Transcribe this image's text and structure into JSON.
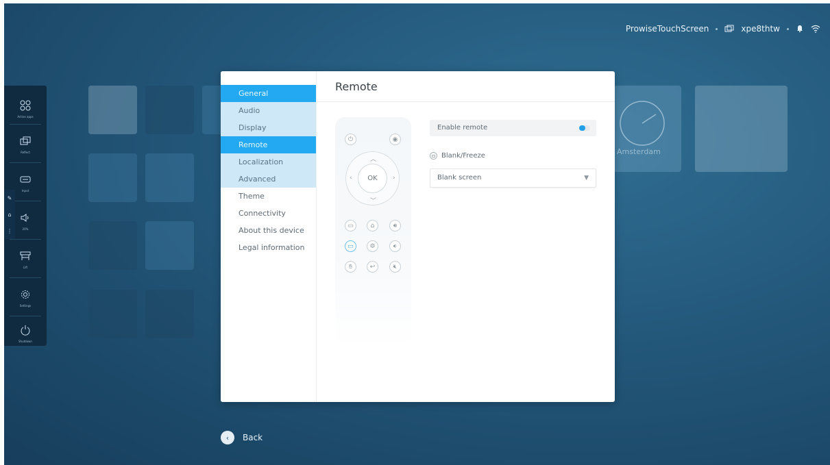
{
  "topbar": {
    "device_name": "ProwiseTouchScreen",
    "code": "xpe8thtw",
    "icons": [
      "screen-share-icon",
      "bell-icon",
      "wifi-icon"
    ]
  },
  "dock": {
    "items": [
      {
        "label": "Active apps",
        "icon": "grid-icon"
      },
      {
        "label": "Reflect",
        "icon": "screen-mirror-icon"
      },
      {
        "label": "Input",
        "icon": "input-icon"
      },
      {
        "label": "20%",
        "icon": "volume-icon"
      },
      {
        "label": "Lift",
        "icon": "lift-icon"
      },
      {
        "label": "Settings",
        "icon": "gear-icon"
      },
      {
        "label": "Shutdown",
        "icon": "power-icon"
      }
    ]
  },
  "background": {
    "tile_label": "Amsterdam"
  },
  "settings": {
    "nav": [
      {
        "label": "General"
      },
      {
        "label": "Audio"
      },
      {
        "label": "Display"
      },
      {
        "label": "Remote"
      },
      {
        "label": "Localization"
      },
      {
        "label": "Advanced"
      },
      {
        "label": "Theme"
      },
      {
        "label": "Connectivity"
      },
      {
        "label": "About this device"
      },
      {
        "label": "Legal information"
      }
    ],
    "title": "Remote",
    "remote": {
      "ok_label": "OK"
    },
    "enable_remote_label": "Enable remote",
    "enable_remote_on": true,
    "blank_freeze_label": "Blank/Freeze",
    "blank_freeze_value": "Blank screen"
  },
  "footer": {
    "back_label": "Back"
  },
  "colors": {
    "accent": "#23a9f2",
    "nav_highlight": "#cfe8f8",
    "background": "#23577a"
  }
}
